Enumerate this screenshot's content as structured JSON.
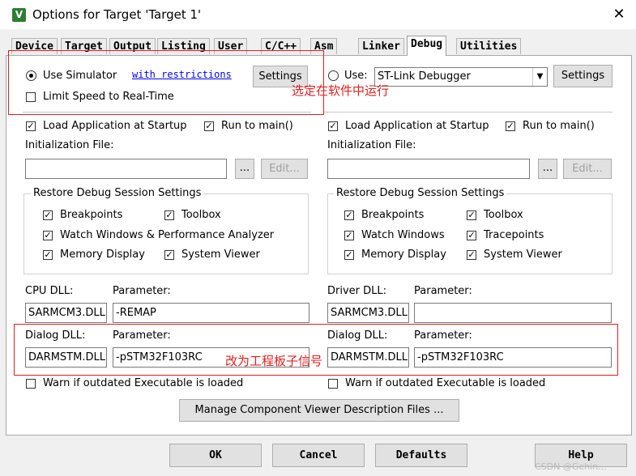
{
  "window": {
    "title": "Options for Target 'Target 1'",
    "icon_letter": "V",
    "close_glyph": "✕"
  },
  "tabs": [
    "Device",
    "Target",
    "Output",
    "Listing",
    "User",
    "C/C++",
    "Asm",
    "Linker",
    "Debug",
    "Utilities"
  ],
  "active_tab": "Debug",
  "left": {
    "use_simulator": "Use Simulator",
    "restrictions_link": "with restrictions",
    "settings_label": "Settings",
    "limit_speed": "Limit Speed to Real-Time",
    "load_app": "Load Application at Startup",
    "run_to_main": "Run to main()",
    "init_file_label": "Initialization File:",
    "init_file_value": "",
    "browse_label": "...",
    "edit_label": "Edit...",
    "restore_group": "Restore Debug Session Settings",
    "breakpoints": "Breakpoints",
    "toolbox": "Toolbox",
    "watch_windows": "Watch Windows & Performance Analyzer",
    "memory_display": "Memory Display",
    "system_viewer": "System Viewer",
    "cpu_dll_label": "CPU DLL:",
    "cpu_param_label": "Parameter:",
    "cpu_dll_value": "SARMCM3.DLL",
    "cpu_param_value": "-REMAP",
    "dialog_dll_label": "Dialog DLL:",
    "dialog_param_label": "Parameter:",
    "dialog_dll_value": "DARMSTM.DLL",
    "dialog_param_value": "-pSTM32F103RC",
    "warn_outdated": "Warn if outdated Executable is loaded"
  },
  "right": {
    "use_label": "Use:",
    "debugger_value": "ST-Link Debugger",
    "settings_label": "Settings",
    "load_app": "Load Application at Startup",
    "run_to_main": "Run to main()",
    "init_file_label": "Initialization File:",
    "init_file_value": "",
    "browse_label": "...",
    "edit_label": "Edit...",
    "restore_group": "Restore Debug Session Settings",
    "breakpoints": "Breakpoints",
    "toolbox": "Toolbox",
    "watch_windows": "Watch Windows",
    "tracepoints": "Tracepoints",
    "memory_display": "Memory Display",
    "system_viewer": "System Viewer",
    "driver_dll_label": "Driver DLL:",
    "driver_param_label": "Parameter:",
    "driver_dll_value": "SARMCM3.DLL",
    "driver_param_value": "",
    "dialog_dll_label": "Dialog DLL:",
    "dialog_param_label": "Parameter:",
    "dialog_dll_value": "DARMSTM.DLL",
    "dialog_param_value": "-pSTM32F103RC",
    "warn_outdated": "Warn if outdated Executable is loaded"
  },
  "manage_button": "Manage Component Viewer Description Files ...",
  "footer": {
    "ok": "OK",
    "cancel": "Cancel",
    "defaults": "Defaults",
    "help": "Help"
  },
  "annotations": {
    "simulator_note": "选定在软件中运行",
    "board_note": "改为工程板子信号"
  },
  "watermark": "CSDN @Gehin...",
  "colors": {
    "annotation": "#e02020",
    "link": "#0000ff",
    "icon_bg": "#2e7d32"
  }
}
